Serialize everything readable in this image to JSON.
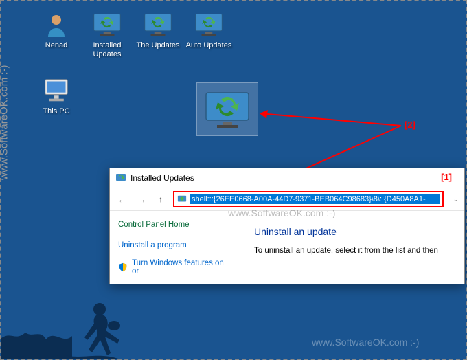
{
  "desktop": {
    "icons": [
      {
        "label": "Nenad"
      },
      {
        "label": "Installed Updates"
      },
      {
        "label": "The Updates"
      },
      {
        "label": "Auto Updates"
      },
      {
        "label": "This PC"
      }
    ]
  },
  "window": {
    "title": "Installed Updates",
    "address": "shell:::{26EE0668-A00A-44D7-9371-BEB064C98683}\\8\\::{D450A8A1-",
    "leftPanel": {
      "heading": "Control Panel Home",
      "link1": "Uninstall a program",
      "link2": "Turn Windows features on or"
    },
    "rightPanel": {
      "heading": "Uninstall an update",
      "body": "To uninstall an update, select it from the list and then"
    }
  },
  "annotations": {
    "a1": "[1]",
    "a2": "[2]"
  },
  "watermark": "www.SoftwareOK.com :-)"
}
